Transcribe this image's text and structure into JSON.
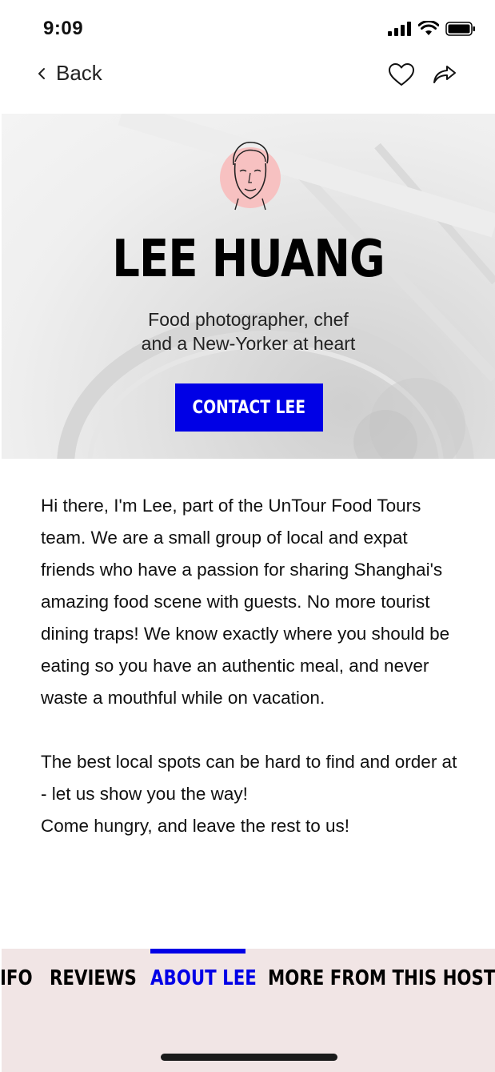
{
  "status_bar": {
    "time": "9:09",
    "icons": [
      "cellular-signal-icon",
      "wifi-icon",
      "battery-icon"
    ]
  },
  "nav": {
    "back_label": "Back",
    "actions": [
      "heart-icon",
      "share-icon"
    ]
  },
  "hero": {
    "name": "LEE HUANG",
    "tagline": "Food photographer, chef\nand a New-Yorker at heart",
    "contact_button": "CONTACT LEE",
    "avatar_bg_color": "#f7c1c1"
  },
  "about": {
    "paragraph1": "Hi there, I'm Lee, part of the UnTour Food Tours team. We are a small group of local and expat friends who have a passion for sharing Shanghai's amazing food scene with guests. No more tourist dining traps! We know exactly where you should be eating so you have an authentic meal, and never waste a mouthful while on vacation.",
    "paragraph2_line1": "The best local spots can be hard to find and order at - let us show you the way!",
    "paragraph2_line2": "Come hungry, and leave the rest to us!"
  },
  "tabs": {
    "items": [
      {
        "label": "IFO",
        "active": false
      },
      {
        "label": "REVIEWS",
        "active": false
      },
      {
        "label": "ABOUT LEE",
        "active": true
      },
      {
        "label": "MORE FROM THIS HOST",
        "active": false
      }
    ]
  },
  "colors": {
    "accent": "#0000e6",
    "tab_bar_bg": "#f1e5e5",
    "text": "#111111"
  }
}
